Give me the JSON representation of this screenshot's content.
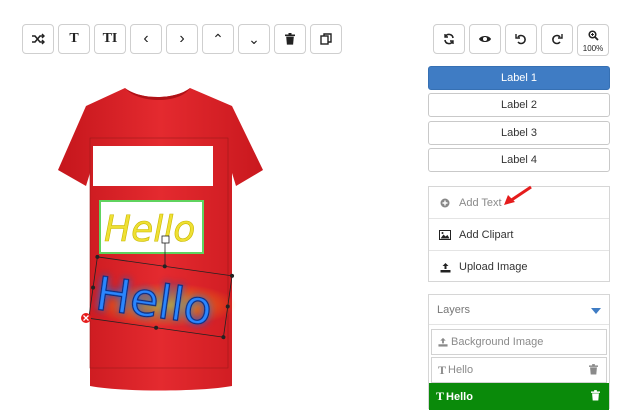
{
  "toolbar": {
    "left": [
      {
        "name": "shuffle-button",
        "icon": "shuffle-icon"
      },
      {
        "name": "text-button",
        "icon": "text-t-icon",
        "glyph": "T"
      },
      {
        "name": "text-size-button",
        "icon": "text-size-icon",
        "glyph": "TI"
      },
      {
        "name": "prev-button",
        "icon": "chevron-left-icon",
        "glyph": "‹"
      },
      {
        "name": "next-button",
        "icon": "chevron-right-icon",
        "glyph": "›"
      },
      {
        "name": "bring-forward-button",
        "icon": "chevron-up-icon",
        "glyph": "⌃"
      },
      {
        "name": "send-backward-button",
        "icon": "chevron-down-icon",
        "glyph": "⌄"
      },
      {
        "name": "delete-button",
        "icon": "trash-icon"
      },
      {
        "name": "duplicate-button",
        "icon": "copy-icon"
      }
    ],
    "right": [
      {
        "name": "refresh-button",
        "icon": "refresh-icon"
      },
      {
        "name": "preview-button",
        "icon": "eye-icon"
      },
      {
        "name": "undo-button",
        "icon": "undo-icon"
      },
      {
        "name": "redo-button",
        "icon": "redo-icon"
      },
      {
        "name": "zoom-button",
        "icon": "zoom-icon",
        "value": "100%"
      }
    ]
  },
  "labels": [
    "Label 1",
    "Label 2",
    "Label 3",
    "Label 4"
  ],
  "actions": {
    "add_text": "Add Text",
    "add_clipart": "Add Clipart",
    "upload_image": "Upload Image"
  },
  "layers": {
    "title": "Layers",
    "items": [
      {
        "label": "Background Image",
        "icon": "upload-icon"
      },
      {
        "label": "Hello",
        "icon": "text-t-icon"
      },
      {
        "label": "Hello",
        "icon": "text-t-icon",
        "active": true
      }
    ]
  },
  "canvas": {
    "text1": "Hello",
    "text2": "Hello",
    "shirt_color": "#e32027",
    "accent_color": "#3f7cc4",
    "active_layer_color": "#0a8a0a"
  }
}
